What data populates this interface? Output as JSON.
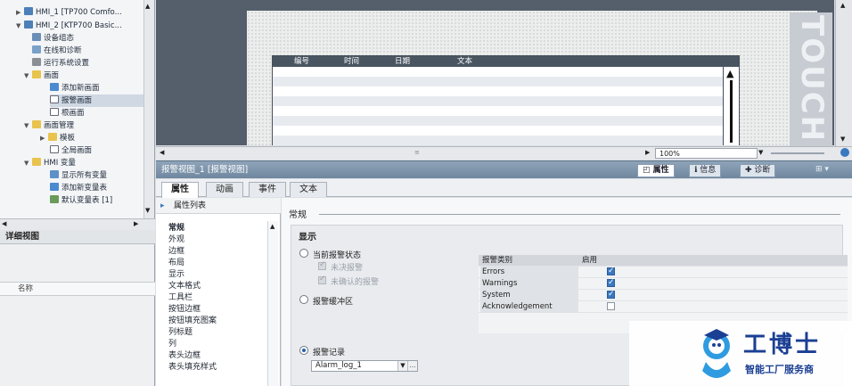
{
  "tree": {
    "items": [
      {
        "label": "HMI_1 [TP700 Comfo..."
      },
      {
        "label": "HMI_2 [KTP700 Basic..."
      },
      {
        "label": "设备组态"
      },
      {
        "label": "在线和诊断"
      },
      {
        "label": "运行系统设置"
      },
      {
        "label": "画面"
      },
      {
        "label": "添加新画面"
      },
      {
        "label": "报警画面"
      },
      {
        "label": "根画面"
      },
      {
        "label": "画面管理"
      },
      {
        "label": "模板"
      },
      {
        "label": "全局画面"
      },
      {
        "label": "HMI 变量"
      },
      {
        "label": "显示所有变量"
      },
      {
        "label": "添加新变量表"
      },
      {
        "label": "默认变量表 [1]"
      }
    ]
  },
  "detail": {
    "title": "详细视图",
    "column": "名称"
  },
  "editor": {
    "alarm_columns": [
      "编号",
      "时间",
      "日期",
      "文本"
    ],
    "touch_text": "TOUCH",
    "zoom": "100%"
  },
  "inspector": {
    "title": "报警视图_1 [报警视图]",
    "tabs": [
      "属性",
      "信息",
      "诊断"
    ],
    "panel_tabs": [
      "属性",
      "动画",
      "事件",
      "文本"
    ],
    "list_title": "属性列表",
    "list_items": [
      "常规",
      "外观",
      "边框",
      "布局",
      "显示",
      "文本格式",
      "工具栏",
      "按钮边框",
      "按钮填充图案",
      "列标题",
      "列",
      "表头边框",
      "表头填充样式"
    ]
  },
  "general": {
    "heading": "常规",
    "section": "显示",
    "radio_current": "当前报警状态",
    "check_unack": "未决报警",
    "check_unconfirmed": "未确认的报警",
    "radio_buffer": "报警缓冲区",
    "radio_log": "报警记录",
    "log_value": "Alarm_log_1",
    "table_header": {
      "class": "报警类别",
      "enabled": "启用"
    },
    "classes": [
      {
        "name": "Errors",
        "enabled": true
      },
      {
        "name": "Warnings",
        "enabled": true
      },
      {
        "name": "System",
        "enabled": true
      },
      {
        "name": "Acknowledgement",
        "enabled": false
      }
    ]
  },
  "logo": {
    "title": "工博士",
    "subtitle": "智能工厂服务商"
  }
}
